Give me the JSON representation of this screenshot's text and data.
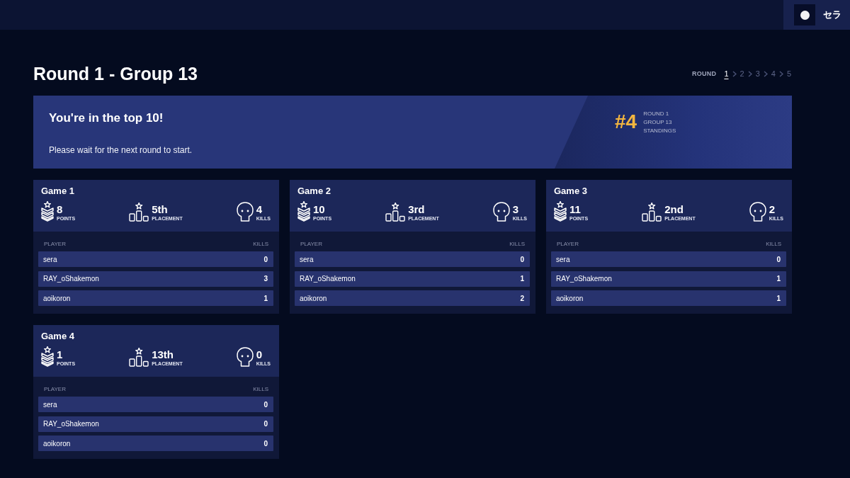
{
  "top_bar": {
    "user": {
      "name": "セラ"
    }
  },
  "header": {
    "title": "Round 1 - Group 13",
    "round_nav": {
      "label": "ROUND",
      "rounds": [
        {
          "label": "1",
          "selected": true
        },
        {
          "label": "2",
          "selected": false
        },
        {
          "label": "3",
          "selected": false
        },
        {
          "label": "4",
          "selected": false
        },
        {
          "label": "5",
          "selected": false
        }
      ]
    }
  },
  "banner": {
    "title": "You're in the top 10!",
    "message": "Please wait for the next round to start.",
    "rank": "#4",
    "rank_lines": [
      "ROUND 1",
      "GROUP 13",
      "STANDINGS"
    ]
  },
  "games": [
    {
      "title": "Game 1",
      "stats": [
        {
          "kind": "points",
          "value": "8",
          "label": "POINTS"
        },
        {
          "kind": "placement",
          "value": "5th",
          "label": "PLACEMENT"
        },
        {
          "kind": "kills",
          "value": "4",
          "label": "KILLS"
        }
      ],
      "columns": [
        "PLAYER",
        "KILLS"
      ],
      "players": [
        {
          "name": "sera",
          "kills": "0"
        },
        {
          "name": "RAY_oShakemon",
          "kills": "3"
        },
        {
          "name": "aoikoron",
          "kills": "1"
        }
      ]
    },
    {
      "title": "Game 2",
      "stats": [
        {
          "kind": "points",
          "value": "10",
          "label": "POINTS"
        },
        {
          "kind": "placement",
          "value": "3rd",
          "label": "PLACEMENT"
        },
        {
          "kind": "kills",
          "value": "3",
          "label": "KILLS"
        }
      ],
      "columns": [
        "PLAYER",
        "KILLS"
      ],
      "players": [
        {
          "name": "sera",
          "kills": "0"
        },
        {
          "name": "RAY_oShakemon",
          "kills": "1"
        },
        {
          "name": "aoikoron",
          "kills": "2"
        }
      ]
    },
    {
      "title": "Game 3",
      "stats": [
        {
          "kind": "points",
          "value": "11",
          "label": "POINTS"
        },
        {
          "kind": "placement",
          "value": "2nd",
          "label": "PLACEMENT"
        },
        {
          "kind": "kills",
          "value": "2",
          "label": "KILLS"
        }
      ],
      "columns": [
        "PLAYER",
        "KILLS"
      ],
      "players": [
        {
          "name": "sera",
          "kills": "0"
        },
        {
          "name": "RAY_oShakemon",
          "kills": "1"
        },
        {
          "name": "aoikoron",
          "kills": "1"
        }
      ]
    },
    {
      "title": "Game 4",
      "stats": [
        {
          "kind": "points",
          "value": "1",
          "label": "POINTS"
        },
        {
          "kind": "placement",
          "value": "13th",
          "label": "PLACEMENT"
        },
        {
          "kind": "kills",
          "value": "0",
          "label": "KILLS"
        }
      ],
      "columns": [
        "PLAYER",
        "KILLS"
      ],
      "players": [
        {
          "name": "sera",
          "kills": "0"
        },
        {
          "name": "RAY_oShakemon",
          "kills": "0"
        },
        {
          "name": "aoikoron",
          "kills": "0"
        }
      ]
    }
  ]
}
